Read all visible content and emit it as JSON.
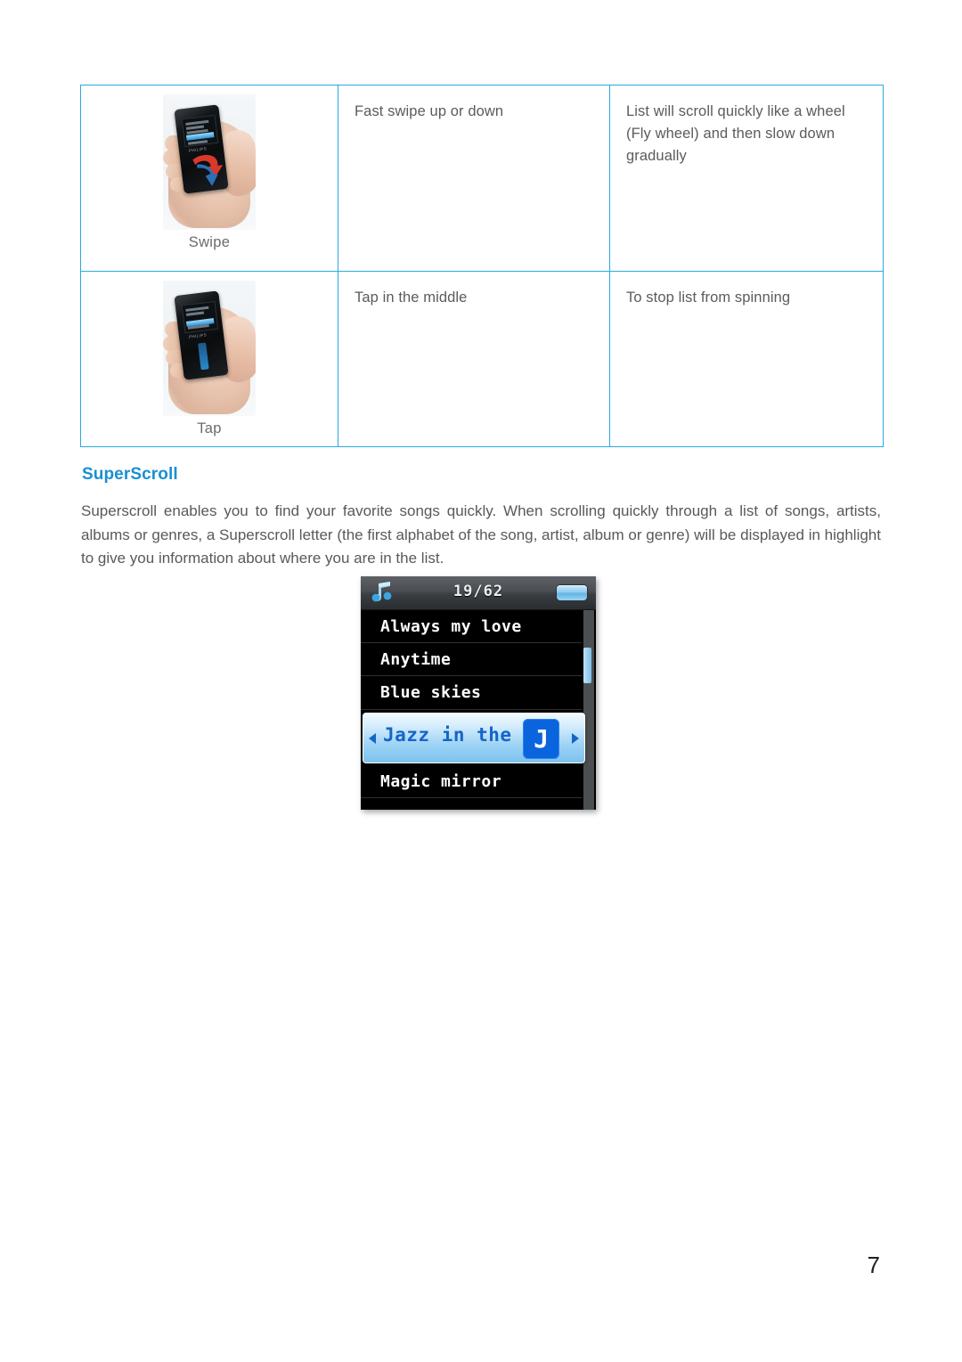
{
  "page": {
    "number": "7",
    "accent_color": "#1a8fd1",
    "table_border_color": "#29a8e0",
    "body_text_color": "#58595b"
  },
  "gesture_table": {
    "rows": [
      {
        "illustration_caption": "Swipe",
        "action": "Fast swipe up or down",
        "result": "List will scroll quickly like a wheel (Fly wheel) and then slow down gradually"
      },
      {
        "illustration_caption": "Tap",
        "action": "Tap in the middle",
        "result": "To stop list from spinning"
      }
    ]
  },
  "section": {
    "heading": "SuperScroll",
    "paragraph": "Superscroll enables you to find your favorite songs quickly. When scrolling quickly through a list of songs, artists, albums or genres, a Superscroll letter (the first alphabet of the song, artist, album or genre) will be displayed in highlight to give you information about where you are in the list."
  },
  "device_screenshot": {
    "statusbar": {
      "icon": "music-note-icon",
      "count": "19/62",
      "battery": "battery-full-icon"
    },
    "list_items": [
      {
        "label": "Always my love",
        "selected": false
      },
      {
        "label": "Anytime",
        "selected": false
      },
      {
        "label": "Blue skies",
        "selected": false
      },
      {
        "label": "Jazz in the",
        "selected": true,
        "superscroll_letter": "J"
      },
      {
        "label": "Magic mirror",
        "selected": false
      }
    ],
    "selected_colors": {
      "text": "#1565c8",
      "letter_badge_bg": "#0a64dd"
    }
  }
}
